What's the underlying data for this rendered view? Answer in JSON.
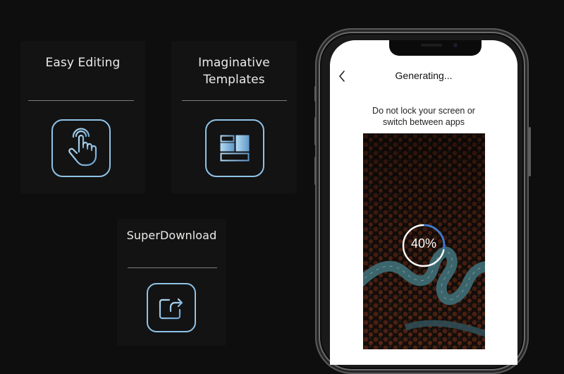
{
  "features": [
    {
      "title": "Easy Editing",
      "icon": "touch-hand-icon"
    },
    {
      "title_line1": "Imaginative",
      "title_line2": "Templates",
      "icon": "template-layout-icon"
    },
    {
      "title": "SuperDownload",
      "icon": "share-export-icon"
    }
  ],
  "phone": {
    "screen_title": "Generating...",
    "back_icon": "chevron-left-icon",
    "message_line1": "Do not lock your screen or",
    "message_line2": "switch between apps",
    "progress": {
      "percent": 40,
      "label": "40%",
      "ring_color": "#ffffff",
      "accent_color": "#3a7bd5"
    }
  },
  "colors": {
    "background": "#0e0e0f",
    "card": "#131314",
    "icon_gradient_start": "#a9d4ef",
    "icon_gradient_end": "#5f97c9"
  }
}
